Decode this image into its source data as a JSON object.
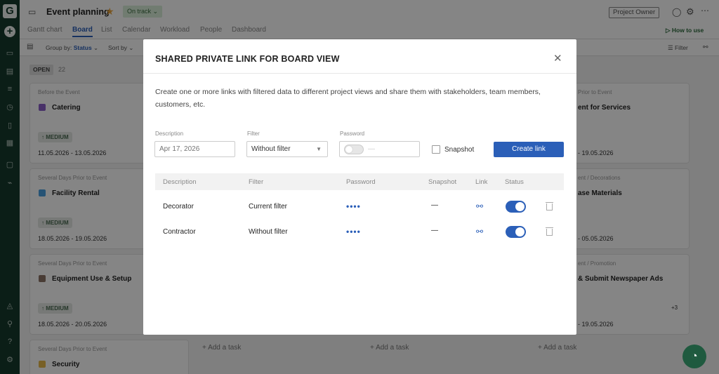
{
  "sidebar": {
    "logo_letter": "G",
    "add_label": "+"
  },
  "header": {
    "project_title": "Event planning",
    "status": "On track",
    "role": "Project Owner",
    "how_to_use": "How to use"
  },
  "tabs": [
    {
      "label": "Gantt chart"
    },
    {
      "label": "Board"
    },
    {
      "label": "List"
    },
    {
      "label": "Calendar"
    },
    {
      "label": "Workload"
    },
    {
      "label": "People"
    },
    {
      "label": "Dashboard"
    }
  ],
  "toolbar": {
    "group_by_label": "Group by:",
    "group_by_value": "Status",
    "sort_by": "Sort by",
    "filter": "Filter"
  },
  "board": {
    "column_status": "OPEN",
    "column_count": "22",
    "add_task": "+ Add a task",
    "cards": [
      {
        "label": "Before the Event",
        "name": "Catering",
        "priority": "↑ MEDIUM",
        "dates": "11.05.2026  -  13.05.2026",
        "color": "#8a5fc7"
      },
      {
        "label": "Several Days Prior to Event",
        "name": "Facility Rental",
        "priority": "↑ MEDIUM",
        "dates": "18.05.2026  -  19.05.2026",
        "color": "#4aa0e0"
      },
      {
        "label": "Several Days Prior to Event",
        "name": "Equipment Use & Setup",
        "priority": "↑ MEDIUM",
        "dates": "18.05.2026  -  20.05.2026",
        "color": "#8c7466"
      },
      {
        "label": "Several Days Prior to Event",
        "name": "Security",
        "color": "#e6b84a"
      }
    ],
    "right_cards": [
      {
        "label": "Prior to Event",
        "name": "ent for Services",
        "dates": "-  19.05.2026"
      },
      {
        "label": "ent / Decorations",
        "name": "ase Materials",
        "dates": "-  05.05.2026"
      },
      {
        "label": "ent / Promotion",
        "name": "& Submit Newspaper Ads",
        "dates": "-  19.05.2026",
        "extra": "+3"
      }
    ]
  },
  "modal": {
    "title": "SHARED PRIVATE LINK FOR BOARD VIEW",
    "description": "Create one or more links with filtered data to different project views and share them with stakeholders, team members, customers, etc.",
    "form": {
      "description_label": "Description",
      "description_placeholder": "Apr 17, 2026",
      "filter_label": "Filter",
      "filter_value": "Without filter",
      "password_label": "Password",
      "password_placeholder": "—",
      "snapshot_label": "Snapshot",
      "create_button": "Create link"
    },
    "table": {
      "headers": [
        "Description",
        "Filter",
        "Password",
        "Snapshot",
        "Link",
        "Status"
      ],
      "rows": [
        {
          "description": "Decorator",
          "filter": "Current filter",
          "password": "••••",
          "snapshot": "—"
        },
        {
          "description": "Contractor",
          "filter": "Without filter",
          "password": "••••",
          "snapshot": "—"
        }
      ]
    }
  }
}
